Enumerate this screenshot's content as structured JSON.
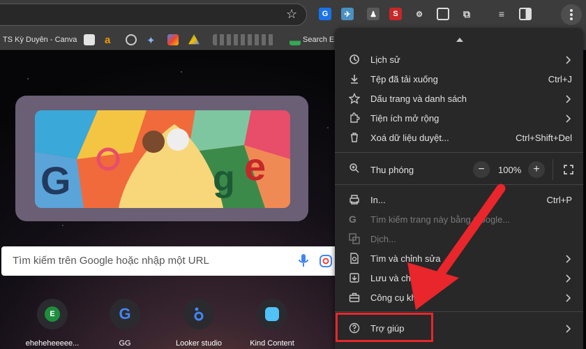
{
  "bookmarks": {
    "items": [
      {
        "label": "TS Kỳ Duyên - Canva"
      },
      {
        "label": "Search Er"
      }
    ]
  },
  "new_tab": {
    "search_placeholder": "Tìm kiếm trên Google hoặc nhập một URL",
    "shortcuts": [
      {
        "label": "eheheheeeee...",
        "initial": "E",
        "color": "#1e8e3e"
      },
      {
        "label": "GG",
        "initial": "G",
        "color": "#4285f4"
      },
      {
        "label": "Looker studio",
        "initial": "",
        "color": "#4285f4"
      },
      {
        "label": "Kind Content",
        "initial": "",
        "color": "#4fc3f7"
      }
    ]
  },
  "menu": {
    "items": [
      {
        "label": "Lịch sử",
        "icon": "history-icon",
        "has_submenu": true
      },
      {
        "label": "Tệp đã tải xuống",
        "icon": "download-icon",
        "shortcut": "Ctrl+J"
      },
      {
        "label": "Dấu trang và danh sách",
        "icon": "star-icon",
        "has_submenu": true
      },
      {
        "label": "Tiện ích mở rộng",
        "icon": "puzzle-icon",
        "has_submenu": true
      },
      {
        "label": "Xoá dữ liệu duyệt...",
        "icon": "trash-icon",
        "shortcut": "Ctrl+Shift+Del"
      },
      {
        "label": "In...",
        "icon": "print-icon",
        "shortcut": "Ctrl+P"
      },
      {
        "label": "Tìm kiếm trang này bằng Google...",
        "icon": "google-g-icon",
        "disabled": true
      },
      {
        "label": "Dịch...",
        "icon": "translate-icon",
        "disabled": true
      },
      {
        "label": "Tìm và chỉnh sửa",
        "icon": "find-icon",
        "has_submenu": true
      },
      {
        "label": "Lưu và chia sẻ",
        "icon": "save-share-icon",
        "has_submenu": true
      },
      {
        "label": "Công cụ khác",
        "icon": "toolbox-icon",
        "has_submenu": true
      },
      {
        "label": "Trợ giúp",
        "icon": "help-icon",
        "has_submenu": true
      }
    ],
    "zoom": {
      "label": "Thu phóng",
      "value": "100%",
      "minus": "−",
      "plus": "+"
    }
  },
  "colors": {
    "highlight": "#e8262b",
    "menu_bg": "#282828"
  }
}
